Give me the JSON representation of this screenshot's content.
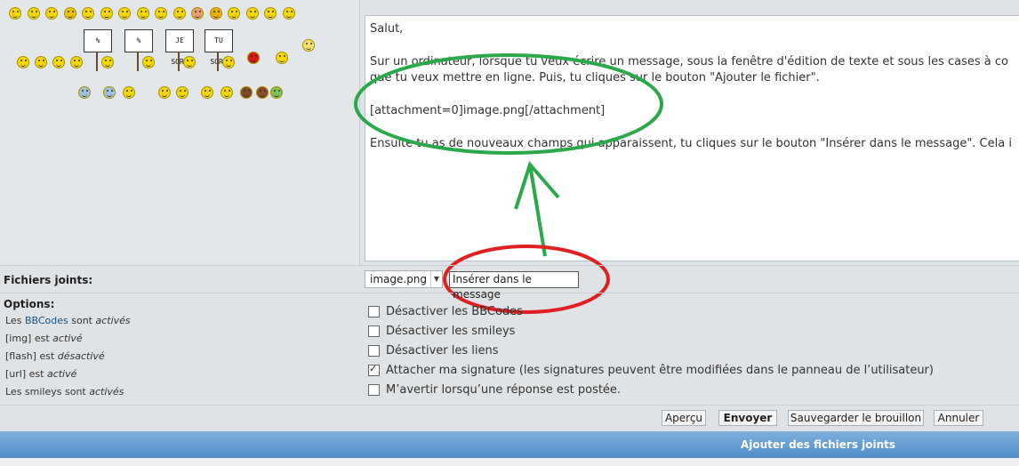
{
  "smileys": {
    "row1": [
      "smile",
      "laugh",
      "grin",
      "mad-hat",
      "sad",
      "confused",
      "cool",
      "happy",
      "wink",
      "blush",
      "angry",
      "evil",
      "lol",
      "dizzy",
      "surprised",
      "exclamation"
    ],
    "row2_left": [
      "question",
      "idea",
      "arrow",
      "neutral"
    ],
    "signs": [
      "%",
      "%",
      "JE SORS",
      "TU SORS"
    ],
    "row2_right": [
      "mr-green",
      "pirate-smoke",
      "wizard"
    ],
    "row3": [
      "thumbs-up",
      "sick",
      "angel",
      "cheer",
      "sleep",
      "in-love",
      "monkey",
      "bear",
      "devil",
      "green"
    ]
  },
  "editor": {
    "lines": [
      "Salut,",
      "",
      "Sur un ordinateur, lorsque tu veux écrire un message, sous la fenêtre d'édition de texte et sous les cases à co",
      "que tu veux mettre en ligne. Puis, tu cliques sur le bouton \"Ajouter le fichier\".",
      "",
      "[attachment=0]image.png[/attachment]",
      "",
      "Ensuite tu as de nouveaux champs qui apparaissent, tu cliques sur le bouton \"Insérer dans le message\". Cela i"
    ]
  },
  "attachments": {
    "label": "Fichiers joints:",
    "selected_file": "image.png",
    "insert_label": "Insérer dans le message"
  },
  "options": {
    "label": "Options:",
    "status": [
      {
        "prefix": "Les ",
        "link": "BBCodes",
        "middle": " sont ",
        "state": "activés"
      },
      {
        "prefix": "[img] est ",
        "link": "",
        "middle": "",
        "state": "activé"
      },
      {
        "prefix": "[flash] est ",
        "link": "",
        "middle": "",
        "state": "désactivé"
      },
      {
        "prefix": "[url] est ",
        "link": "",
        "middle": "",
        "state": "activé"
      },
      {
        "prefix": "Les smileys sont ",
        "link": "",
        "middle": "",
        "state": "activés"
      }
    ],
    "checkboxes": [
      {
        "label": "Désactiver les BBCodes",
        "checked": false
      },
      {
        "label": "Désactiver les smileys",
        "checked": false
      },
      {
        "label": "Désactiver les liens",
        "checked": false
      },
      {
        "label": "Attacher ma signature (les signatures peuvent être modifiées dans le panneau de l’utilisateur)",
        "checked": true
      },
      {
        "label": "M’avertir lorsqu’une réponse est postée.",
        "checked": false
      }
    ]
  },
  "buttons": {
    "preview": "Aperçu",
    "submit": "Envoyer",
    "save_draft": "Sauvegarder le brouillon",
    "cancel": "Annuler"
  },
  "section_bar": {
    "title": "Ajouter des fichiers joints"
  },
  "colors": {
    "annotation_green": "#2aa84a",
    "annotation_red": "#e02020",
    "link": "#105289",
    "bar": "#4f8ec8"
  }
}
